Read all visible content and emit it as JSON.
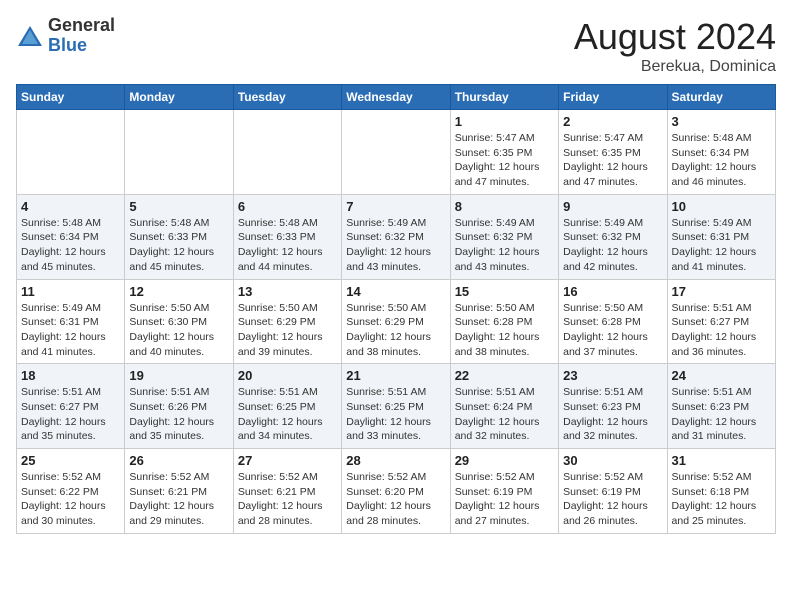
{
  "logo": {
    "general": "General",
    "blue": "Blue"
  },
  "header": {
    "month_year": "August 2024",
    "location": "Berekua, Dominica"
  },
  "weekdays": [
    "Sunday",
    "Monday",
    "Tuesday",
    "Wednesday",
    "Thursday",
    "Friday",
    "Saturday"
  ],
  "weeks": [
    [
      {
        "day": "",
        "info": ""
      },
      {
        "day": "",
        "info": ""
      },
      {
        "day": "",
        "info": ""
      },
      {
        "day": "",
        "info": ""
      },
      {
        "day": "1",
        "info": "Sunrise: 5:47 AM\nSunset: 6:35 PM\nDaylight: 12 hours\nand 47 minutes."
      },
      {
        "day": "2",
        "info": "Sunrise: 5:47 AM\nSunset: 6:35 PM\nDaylight: 12 hours\nand 47 minutes."
      },
      {
        "day": "3",
        "info": "Sunrise: 5:48 AM\nSunset: 6:34 PM\nDaylight: 12 hours\nand 46 minutes."
      }
    ],
    [
      {
        "day": "4",
        "info": "Sunrise: 5:48 AM\nSunset: 6:34 PM\nDaylight: 12 hours\nand 45 minutes."
      },
      {
        "day": "5",
        "info": "Sunrise: 5:48 AM\nSunset: 6:33 PM\nDaylight: 12 hours\nand 45 minutes."
      },
      {
        "day": "6",
        "info": "Sunrise: 5:48 AM\nSunset: 6:33 PM\nDaylight: 12 hours\nand 44 minutes."
      },
      {
        "day": "7",
        "info": "Sunrise: 5:49 AM\nSunset: 6:32 PM\nDaylight: 12 hours\nand 43 minutes."
      },
      {
        "day": "8",
        "info": "Sunrise: 5:49 AM\nSunset: 6:32 PM\nDaylight: 12 hours\nand 43 minutes."
      },
      {
        "day": "9",
        "info": "Sunrise: 5:49 AM\nSunset: 6:32 PM\nDaylight: 12 hours\nand 42 minutes."
      },
      {
        "day": "10",
        "info": "Sunrise: 5:49 AM\nSunset: 6:31 PM\nDaylight: 12 hours\nand 41 minutes."
      }
    ],
    [
      {
        "day": "11",
        "info": "Sunrise: 5:49 AM\nSunset: 6:31 PM\nDaylight: 12 hours\nand 41 minutes."
      },
      {
        "day": "12",
        "info": "Sunrise: 5:50 AM\nSunset: 6:30 PM\nDaylight: 12 hours\nand 40 minutes."
      },
      {
        "day": "13",
        "info": "Sunrise: 5:50 AM\nSunset: 6:29 PM\nDaylight: 12 hours\nand 39 minutes."
      },
      {
        "day": "14",
        "info": "Sunrise: 5:50 AM\nSunset: 6:29 PM\nDaylight: 12 hours\nand 38 minutes."
      },
      {
        "day": "15",
        "info": "Sunrise: 5:50 AM\nSunset: 6:28 PM\nDaylight: 12 hours\nand 38 minutes."
      },
      {
        "day": "16",
        "info": "Sunrise: 5:50 AM\nSunset: 6:28 PM\nDaylight: 12 hours\nand 37 minutes."
      },
      {
        "day": "17",
        "info": "Sunrise: 5:51 AM\nSunset: 6:27 PM\nDaylight: 12 hours\nand 36 minutes."
      }
    ],
    [
      {
        "day": "18",
        "info": "Sunrise: 5:51 AM\nSunset: 6:27 PM\nDaylight: 12 hours\nand 35 minutes."
      },
      {
        "day": "19",
        "info": "Sunrise: 5:51 AM\nSunset: 6:26 PM\nDaylight: 12 hours\nand 35 minutes."
      },
      {
        "day": "20",
        "info": "Sunrise: 5:51 AM\nSunset: 6:25 PM\nDaylight: 12 hours\nand 34 minutes."
      },
      {
        "day": "21",
        "info": "Sunrise: 5:51 AM\nSunset: 6:25 PM\nDaylight: 12 hours\nand 33 minutes."
      },
      {
        "day": "22",
        "info": "Sunrise: 5:51 AM\nSunset: 6:24 PM\nDaylight: 12 hours\nand 32 minutes."
      },
      {
        "day": "23",
        "info": "Sunrise: 5:51 AM\nSunset: 6:23 PM\nDaylight: 12 hours\nand 32 minutes."
      },
      {
        "day": "24",
        "info": "Sunrise: 5:51 AM\nSunset: 6:23 PM\nDaylight: 12 hours\nand 31 minutes."
      }
    ],
    [
      {
        "day": "25",
        "info": "Sunrise: 5:52 AM\nSunset: 6:22 PM\nDaylight: 12 hours\nand 30 minutes."
      },
      {
        "day": "26",
        "info": "Sunrise: 5:52 AM\nSunset: 6:21 PM\nDaylight: 12 hours\nand 29 minutes."
      },
      {
        "day": "27",
        "info": "Sunrise: 5:52 AM\nSunset: 6:21 PM\nDaylight: 12 hours\nand 28 minutes."
      },
      {
        "day": "28",
        "info": "Sunrise: 5:52 AM\nSunset: 6:20 PM\nDaylight: 12 hours\nand 28 minutes."
      },
      {
        "day": "29",
        "info": "Sunrise: 5:52 AM\nSunset: 6:19 PM\nDaylight: 12 hours\nand 27 minutes."
      },
      {
        "day": "30",
        "info": "Sunrise: 5:52 AM\nSunset: 6:19 PM\nDaylight: 12 hours\nand 26 minutes."
      },
      {
        "day": "31",
        "info": "Sunrise: 5:52 AM\nSunset: 6:18 PM\nDaylight: 12 hours\nand 25 minutes."
      }
    ]
  ]
}
